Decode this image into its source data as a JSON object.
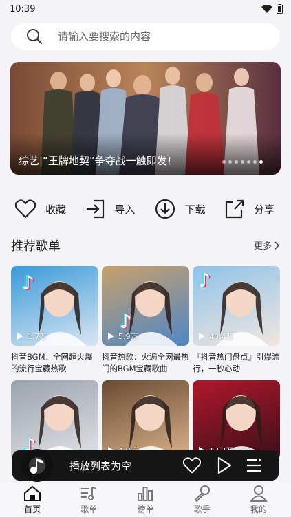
{
  "status": {
    "time": "10:39"
  },
  "search": {
    "placeholder": "请输入要搜索的内容"
  },
  "banner": {
    "title": "综艺|“王牌地契”争夺战一触即发！",
    "dot_count": 7,
    "active_dot": 6
  },
  "actions": [
    {
      "label": "收藏",
      "icon": "heart-icon"
    },
    {
      "label": "导入",
      "icon": "import-icon"
    },
    {
      "label": "下载",
      "icon": "download-icon"
    },
    {
      "label": "分享",
      "icon": "share-icon"
    }
  ],
  "section": {
    "title": "推荐歌单",
    "more": "更多"
  },
  "playlists": [
    {
      "title": "抖音BGM：全网超火爆的流行宝藏热歌",
      "plays": "1.7万",
      "colors": [
        "#3a9ad9",
        "#dbe6f2"
      ]
    },
    {
      "title": "抖音热歌：火遍全网最热门的BGM宝藏歌曲",
      "plays": "5.9万",
      "colors": [
        "#c7a06c",
        "#4f86c6"
      ]
    },
    {
      "title": "『抖音热门盘点』引爆流行，一秒心动",
      "plays": "40.4万",
      "colors": [
        "#8fc3e8",
        "#f1e6df"
      ]
    },
    {
      "title": "",
      "plays": "",
      "colors": [
        "#9aa3ad",
        "#e2e2e6"
      ]
    },
    {
      "title": "",
      "plays": "4.8万",
      "colors": [
        "#6b4a33",
        "#d8b48a"
      ]
    },
    {
      "title": "",
      "plays": "13.7万",
      "colors": [
        "#b0182a",
        "#3b0f1a"
      ]
    }
  ],
  "player": {
    "text": "播放列表为空"
  },
  "tabs": [
    {
      "label": "首页",
      "icon": "home-icon",
      "active": true
    },
    {
      "label": "歌单",
      "icon": "playlist-icon",
      "active": false
    },
    {
      "label": "榜单",
      "icon": "chart-icon",
      "active": false
    },
    {
      "label": "歌手",
      "icon": "microphone-icon",
      "active": false
    },
    {
      "label": "我的",
      "icon": "user-icon",
      "active": false
    }
  ]
}
